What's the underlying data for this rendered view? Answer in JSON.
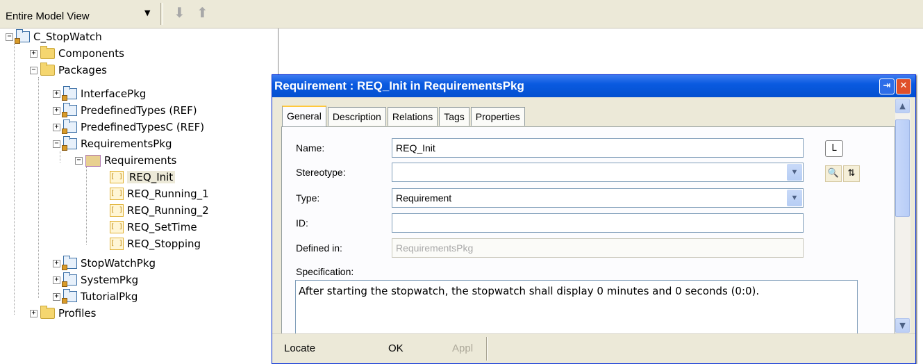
{
  "toolbar": {
    "view_select": "Entire Model View",
    "down_arrow_icon": "arrow-down-icon",
    "up_arrow_icon": "arrow-up-icon"
  },
  "tree": {
    "root": "C_StopWatch",
    "components": "Components",
    "packages": "Packages",
    "interface_pkg": "InterfacePkg",
    "predefined_types": "PredefinedTypes (REF)",
    "predefined_types_c": "PredefinedTypesC (REF)",
    "requirements_pkg": "RequirementsPkg",
    "requirements": "Requirements",
    "req_init": "REQ_Init",
    "req_running_1": "REQ_Running_1",
    "req_running_2": "REQ_Running_2",
    "req_settime": "REQ_SetTime",
    "req_stopping": "REQ_Stopping",
    "stopwatch_pkg": "StopWatchPkg",
    "system_pkg": "SystemPkg",
    "tutorial_pkg": "TutorialPkg",
    "profiles": "Profiles"
  },
  "dialog": {
    "title": "Requirement : REQ_Init in RequirementsPkg",
    "tabs": [
      "General",
      "Description",
      "Relations",
      "Tags",
      "Properties"
    ],
    "fields": {
      "name_label": "Name:",
      "name_value": "REQ_Init",
      "stereotype_label": "Stereotype:",
      "stereotype_value": "",
      "type_label": "Type:",
      "type_value": "Requirement",
      "id_label": "ID:",
      "id_value": "",
      "defined_in_label": "Defined in:",
      "defined_in_value": "RequirementsPkg",
      "specification_label": "Specification:",
      "specification_value": "After starting the stopwatch, the stopwatch shall display 0 minutes and 0 seconds (0:0)."
    },
    "l_button": "L",
    "buttons": {
      "locate": "Locate",
      "ok": "OK",
      "apply": "Appl"
    }
  }
}
